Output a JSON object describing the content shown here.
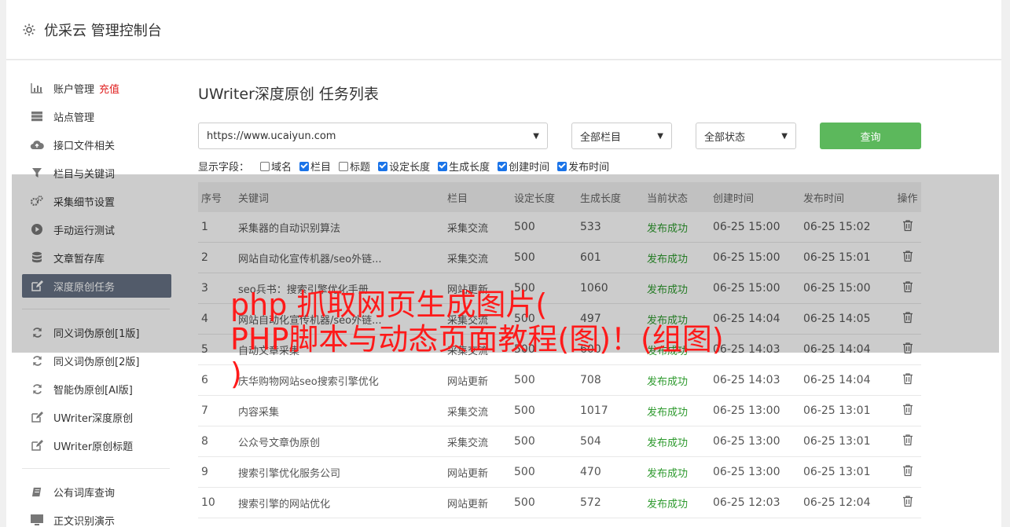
{
  "header": {
    "title": "优采云 管理控制台"
  },
  "sidebar": {
    "items": [
      {
        "label": "账户管理",
        "badge": "充值",
        "icon": "bar-chart-icon"
      },
      {
        "label": "站点管理",
        "icon": "server-icon"
      },
      {
        "label": "接口文件相关",
        "icon": "cloud-upload-icon"
      },
      {
        "label": "栏目与关键词",
        "icon": "filter-icon"
      },
      {
        "label": "采集细节设置",
        "icon": "gears-icon"
      },
      {
        "label": "手动运行测试",
        "icon": "play-circle-icon"
      },
      {
        "label": "文章暂存库",
        "icon": "database-icon"
      },
      {
        "label": "深度原创任务",
        "icon": "edit-icon",
        "active": true
      }
    ],
    "items2": [
      {
        "label": "同义词伪原创[1版]",
        "icon": "refresh-icon"
      },
      {
        "label": "同义词伪原创[2版]",
        "icon": "refresh-icon"
      },
      {
        "label": "智能伪原创[AI版]",
        "icon": "refresh-icon"
      },
      {
        "label": "UWriter深度原创",
        "icon": "edit-icon"
      },
      {
        "label": "UWriter原创标题",
        "icon": "edit-icon"
      }
    ],
    "items3": [
      {
        "label": "公有词库查询",
        "icon": "book-icon"
      },
      {
        "label": "正文识别演示",
        "icon": "monitor-icon"
      }
    ]
  },
  "main": {
    "title": "UWriter深度原创 任务列表",
    "site_select": "https://www.ucaiyun.com",
    "column_select": "全部栏目",
    "status_select": "全部状态",
    "query_button": "查询",
    "fields_label": "显示字段：",
    "fields": [
      {
        "label": "域名",
        "checked": false
      },
      {
        "label": "栏目",
        "checked": true
      },
      {
        "label": "标题",
        "checked": false
      },
      {
        "label": "设定长度",
        "checked": true
      },
      {
        "label": "生成长度",
        "checked": true
      },
      {
        "label": "创建时间",
        "checked": true
      },
      {
        "label": "发布时间",
        "checked": true
      }
    ],
    "table": {
      "headers": [
        "序号",
        "关键词",
        "栏目",
        "设定长度",
        "生成长度",
        "当前状态",
        "创建时间",
        "发布时间",
        "操作"
      ],
      "rows": [
        [
          "1",
          "采集器的自动识别算法",
          "采集交流",
          "500",
          "533",
          "发布成功",
          "06-25 15:00",
          "06-25 15:02"
        ],
        [
          "2",
          "网站自动化宣传机器/seo外链...",
          "采集交流",
          "500",
          "601",
          "发布成功",
          "06-25 15:00",
          "06-25 15:01"
        ],
        [
          "3",
          "seo兵书：搜索引擎优化手册",
          "网站更新",
          "500",
          "1060",
          "发布成功",
          "06-25 15:00",
          "06-25 15:00"
        ],
        [
          "4",
          "网站自动化宣传机器/seo外链...",
          "采集交流",
          "500",
          "497",
          "发布成功",
          "06-25 14:04",
          "06-25 14:05"
        ],
        [
          "5",
          "自动文章采集",
          "采集交流",
          "500",
          "600",
          "发布成功",
          "06-25 14:03",
          "06-25 14:04"
        ],
        [
          "6",
          "庆华购物网站seo搜索引擎优化",
          "网站更新",
          "500",
          "708",
          "发布成功",
          "06-25 14:03",
          "06-25 14:04"
        ],
        [
          "7",
          "内容采集",
          "采集交流",
          "500",
          "1017",
          "发布成功",
          "06-25 13:00",
          "06-25 13:01"
        ],
        [
          "8",
          "公众号文章伪原创",
          "采集交流",
          "500",
          "504",
          "发布成功",
          "06-25 13:00",
          "06-25 13:01"
        ],
        [
          "9",
          "搜索引擎优化服务公司",
          "网站更新",
          "500",
          "470",
          "发布成功",
          "06-25 13:00",
          "06-25 13:01"
        ],
        [
          "10",
          "搜索引擎的网站优化",
          "网站更新",
          "500",
          "572",
          "发布成功",
          "06-25 12:03",
          "06-25 12:04"
        ]
      ]
    }
  },
  "overlay": {
    "line1": "php 抓取网页生成图片(",
    "line2": "PHP脚本与动态页面教程(图)！(组图)",
    "line3": ")"
  },
  "colors": {
    "active_nav": "#677285",
    "success": "#2e9a2e",
    "query_btn": "#5cb85c",
    "overlay_text": "#ff1a1a",
    "badge": "#e02020"
  }
}
